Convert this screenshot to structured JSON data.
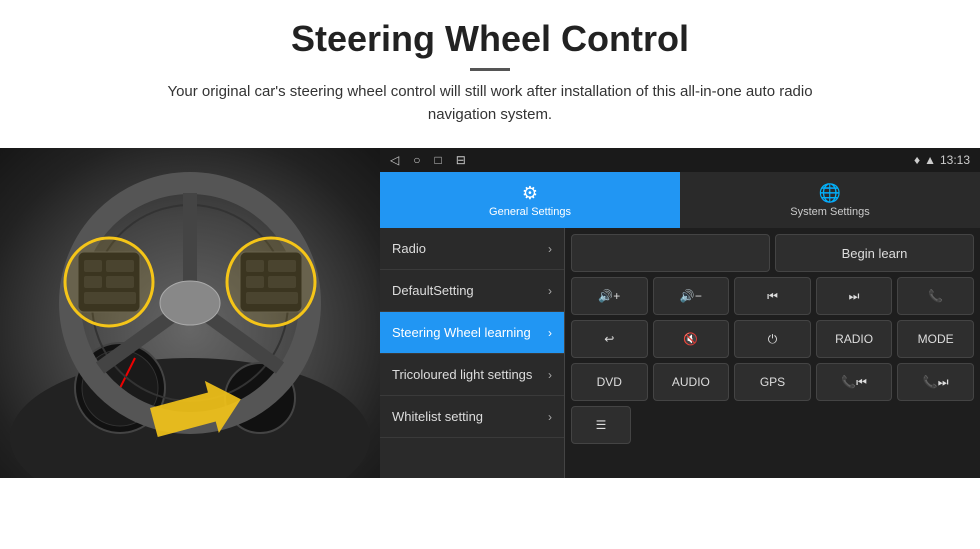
{
  "header": {
    "title": "Steering Wheel Control",
    "subtitle": "Your original car's steering wheel control will still work after installation of this all-in-one auto radio navigation system."
  },
  "statusBar": {
    "time": "13:13",
    "icons": [
      "◁",
      "○",
      "□",
      "⊟"
    ]
  },
  "tabs": [
    {
      "id": "general",
      "label": "General Settings",
      "icon": "⚙",
      "active": true
    },
    {
      "id": "system",
      "label": "System Settings",
      "icon": "🌐",
      "active": false
    }
  ],
  "menuItems": [
    {
      "id": "radio",
      "label": "Radio",
      "active": false
    },
    {
      "id": "default",
      "label": "DefaultSetting",
      "active": false
    },
    {
      "id": "steering",
      "label": "Steering Wheel learning",
      "active": true
    },
    {
      "id": "tricoloured",
      "label": "Tricoloured light settings",
      "active": false
    },
    {
      "id": "whitelist",
      "label": "Whitelist setting",
      "active": false
    }
  ],
  "controlPanel": {
    "beginLearnLabel": "Begin learn",
    "row1": [
      "🔊+",
      "🔊−",
      "⏮",
      "⏭",
      "📞"
    ],
    "row2": [
      "↩",
      "🔊✕",
      "⏻",
      "RADIO",
      "MODE"
    ],
    "row3": [
      "DVD",
      "AUDIO",
      "GPS",
      "📞⏮",
      "📞⏭"
    ],
    "row4": [
      "≡"
    ]
  }
}
